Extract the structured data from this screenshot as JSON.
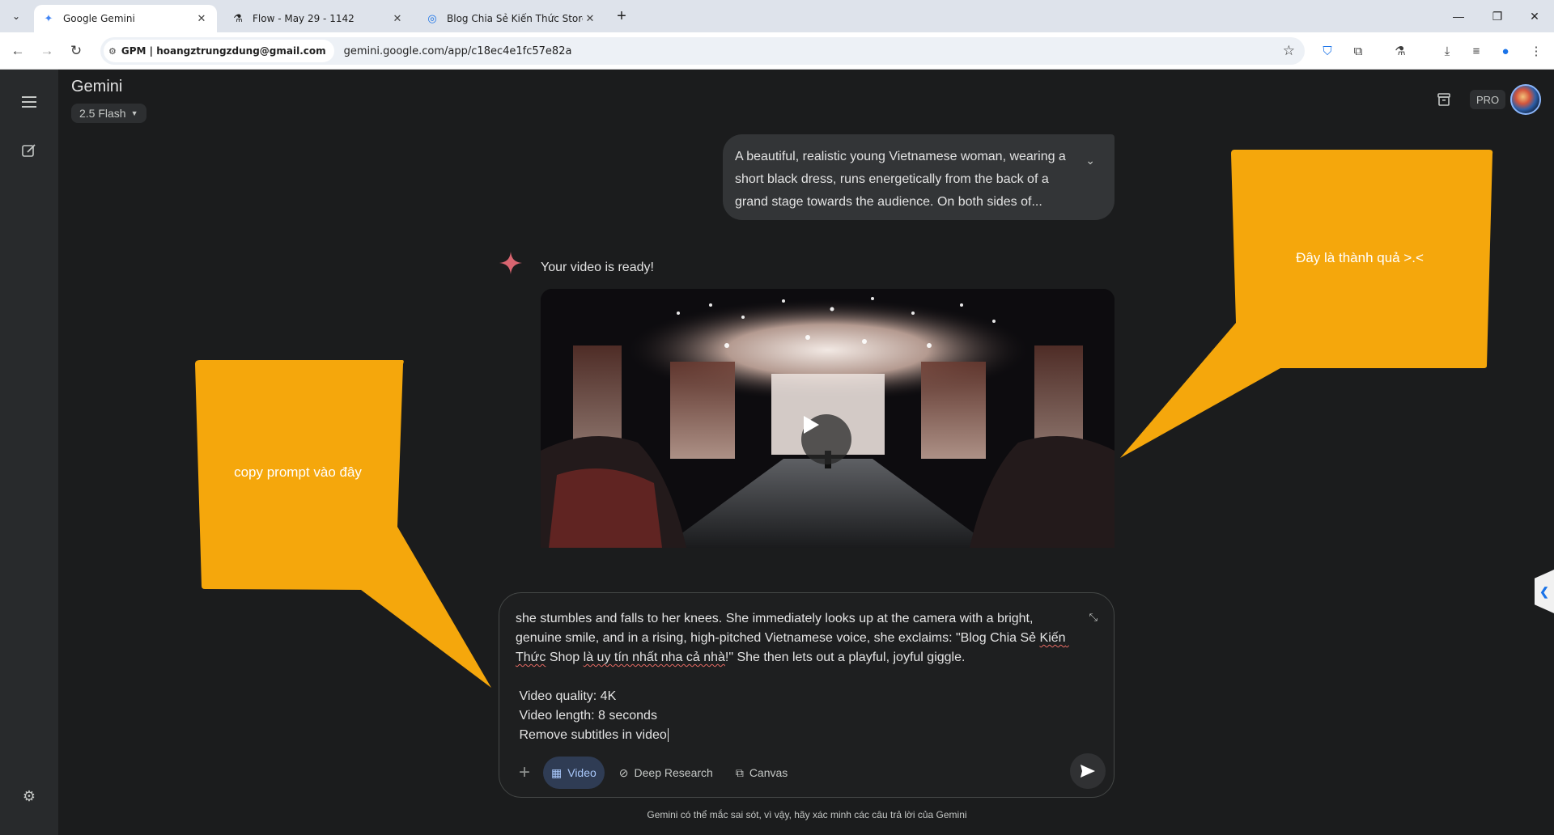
{
  "browser": {
    "tabs": [
      {
        "title": "Google Gemini",
        "icon": "gemini-icon",
        "active": true
      },
      {
        "title": "Flow - May 29 - 1142",
        "icon": "flask-icon",
        "active": false
      },
      {
        "title": "Blog Chia Sẻ Kiến Thức Store -",
        "icon": "blog-icon",
        "active": false
      }
    ],
    "profile_chip": "GPM | hoangztrungzdung@gmail.com",
    "url": "gemini.google.com/app/c18ec4e1fc57e82a"
  },
  "app": {
    "title": "Gemini",
    "model": "2.5 Flash",
    "pro_badge": "PRO"
  },
  "conversation": {
    "user_prompt_preview": "A beautiful, realistic young Vietnamese woman, wearing a short black dress, runs energetically from the back of a grand stage towards the audience. On both sides of...",
    "response_text": "Your video is ready!"
  },
  "composer": {
    "line1_a": "she stumbles and falls to her knees. She immediately looks up at the camera with a bright, genuine smile, and in a rising, high-pitched Vietnamese voice, she exclaims: \"Blog Chia Sẻ ",
    "line1_b": "Kiến Thức",
    "line1_c": " Shop ",
    "line1_d": "là uy tín nhất nha cả nhà",
    "line1_e": "!\" She then lets out a playful, joyful giggle.",
    "spec1": " Video quality: 4K",
    "spec2": " Video length: 8 seconds",
    "spec3": " Remove subtitles in video",
    "tools": [
      {
        "label": "Video",
        "icon": "calendar-video-icon",
        "active": true
      },
      {
        "label": "Deep Research",
        "icon": "deep-research-icon",
        "active": false
      },
      {
        "label": "Canvas",
        "icon": "canvas-icon",
        "active": false
      }
    ]
  },
  "disclaimer": "Gemini có thể mắc sai sót, vì vậy, hãy xác minh các câu trả lời của Gemini",
  "annotations": {
    "left_callout": "copy prompt vào đây",
    "right_callout": "Đây là thành quả >.<",
    "callout_color": "#f5a70c"
  }
}
